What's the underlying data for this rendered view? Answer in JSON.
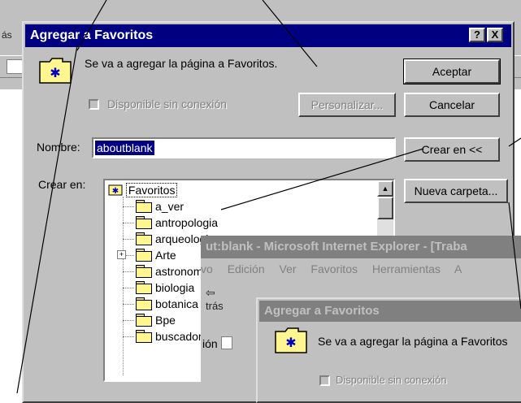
{
  "background_window": {
    "partial_label": "ás"
  },
  "dialog": {
    "title": "Agregar a Favoritos",
    "help_button": "?",
    "close_button": "X",
    "message": "Se va a agregar la página a Favoritos.",
    "offline_checkbox": "Disponible sin conexión",
    "customize_button": "Personalizar...",
    "ok_button": "Aceptar",
    "cancel_button": "Cancelar",
    "name_label": "Nombre:",
    "name_value": "aboutblank",
    "create_in_button": "Crear en <<",
    "create_in_label": "Crear en:",
    "new_folder_button": "Nueva carpeta...",
    "tree": {
      "root": "Favoritos",
      "items": [
        "a_ver",
        "antropologia",
        "arqueologia",
        "Arte",
        "astronomia",
        "biologia",
        "botanica",
        "Bpe",
        "buscadores"
      ]
    }
  },
  "ie_window": {
    "title": "ut:blank - Microsoft Internet Explorer - [Traba",
    "menu": [
      "vo",
      "Edición",
      "Ver",
      "Favoritos",
      "Herramientas",
      "A"
    ],
    "back_label": "trás",
    "address_label": "ión"
  },
  "dialog2": {
    "title": "Agregar a Favoritos",
    "message": "Se va a agregar la página a Favoritos",
    "offline_checkbox": "Disponible sin conexión"
  },
  "colors": {
    "title_active": "#000080",
    "title_inactive": "#808080",
    "face": "#c0c0c0",
    "selection": "#000080"
  }
}
